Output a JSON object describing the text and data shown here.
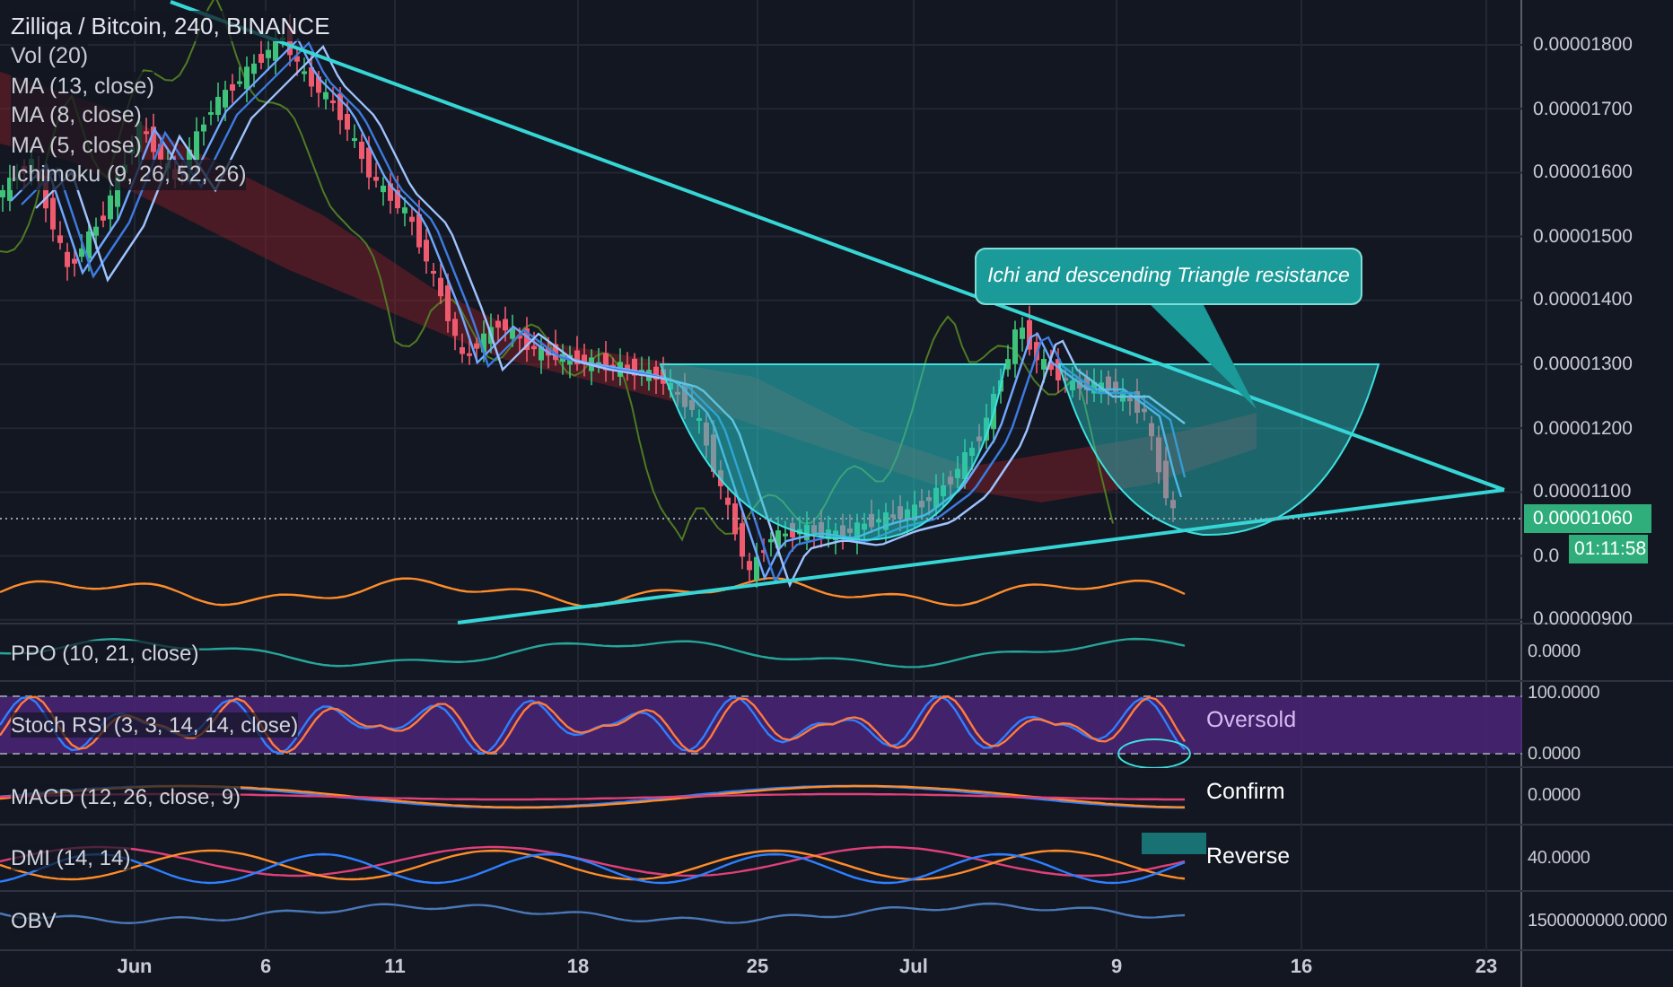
{
  "symbol": {
    "title": "Zilliqa / Bitcoin, 240, BINANCE"
  },
  "main_legend": [
    "Vol (20)",
    "MA (13, close)",
    "MA (8, close)",
    "MA (5, close)",
    "Ichimoku (9, 26, 52, 26)"
  ],
  "price_axis": {
    "ticks": [
      "0.00001800",
      "0.00001700",
      "0.00001600",
      "0.00001500",
      "0.00001400",
      "0.00001300",
      "0.00001200",
      "0.00001100",
      "0.0",
      "0.00000900"
    ],
    "last_price": "0.00001060",
    "countdown": "01:11:58"
  },
  "callout": {
    "text": "Ichi and descending Triangle resistance"
  },
  "panes": [
    {
      "kind": "ppo",
      "name": "PPO (10, 21, close)",
      "scale": [
        "0.0000"
      ]
    },
    {
      "kind": "stoch",
      "name": "Stoch RSI (3, 3, 14, 14, close)",
      "scale": [
        "100.0000",
        "0.0000"
      ],
      "note": "Oversold"
    },
    {
      "kind": "macd",
      "name": "MACD (12, 26, close, 9)",
      "scale": [
        "0.0000"
      ],
      "note": "Confirm"
    },
    {
      "kind": "dmi",
      "name": "DMI (14, 14)",
      "scale": [
        "40.0000"
      ],
      "note": "Reverse"
    },
    {
      "kind": "obv",
      "name": "OBV",
      "scale": [
        "1500000000.0000"
      ]
    }
  ],
  "time_axis": [
    "Jun",
    "6",
    "11",
    "18",
    "25",
    "Jul",
    "9",
    "16",
    "23"
  ]
}
